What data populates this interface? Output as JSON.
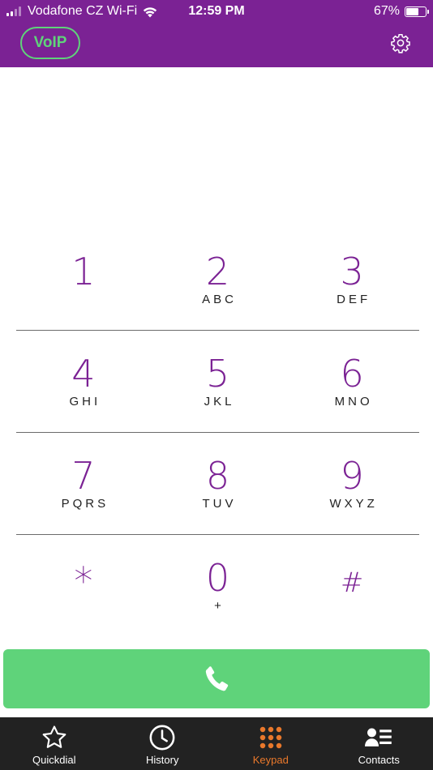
{
  "status_bar": {
    "carrier": "Vodafone CZ Wi-Fi",
    "time": "12:59 PM",
    "battery_text": "67%",
    "battery_level": 0.67
  },
  "header": {
    "badge_label": "VoIP",
    "settings_icon": "gear-icon"
  },
  "keypad": {
    "rows": [
      [
        {
          "digit": "1",
          "letters": ""
        },
        {
          "digit": "2",
          "letters": "ABC"
        },
        {
          "digit": "3",
          "letters": "DEF"
        }
      ],
      [
        {
          "digit": "4",
          "letters": "GHI"
        },
        {
          "digit": "5",
          "letters": "JKL"
        },
        {
          "digit": "6",
          "letters": "MNO"
        }
      ],
      [
        {
          "digit": "7",
          "letters": "PQRS"
        },
        {
          "digit": "8",
          "letters": "TUV"
        },
        {
          "digit": "9",
          "letters": "WXYZ"
        }
      ],
      [
        {
          "digit": "*",
          "letters": ""
        },
        {
          "digit": "0",
          "letters": "+"
        },
        {
          "digit": "#",
          "letters": ""
        }
      ]
    ]
  },
  "call_button": {
    "icon": "phone-icon"
  },
  "tabs": [
    {
      "label": "Quickdial",
      "icon": "star-icon",
      "active": false
    },
    {
      "label": "History",
      "icon": "clock-icon",
      "active": false
    },
    {
      "label": "Keypad",
      "icon": "keypad-icon",
      "active": true
    },
    {
      "label": "Contacts",
      "icon": "contacts-icon",
      "active": false
    }
  ],
  "colors": {
    "header_bg": "#7b2294",
    "digit": "#7b2294",
    "accent_green": "#5fd37a",
    "tabbar_bg": "#222222",
    "tab_active": "#e9782b"
  }
}
